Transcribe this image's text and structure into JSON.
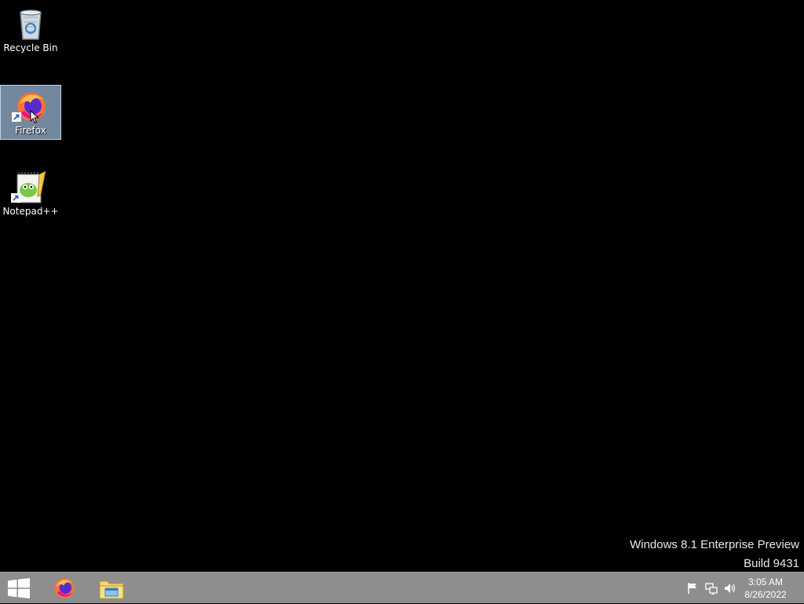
{
  "desktop": {
    "icons": [
      {
        "label": "Recycle Bin",
        "icon": "recycle-bin-icon"
      },
      {
        "label": "Firefox",
        "icon": "firefox-icon",
        "selected": true
      },
      {
        "label": "Notepad++",
        "icon": "notepad-plus-plus-icon"
      }
    ],
    "watermark": {
      "line1": "Windows 8.1 Enterprise Preview",
      "line2": "Build 9431"
    }
  },
  "taskbar": {
    "start_icon": "windows-logo-icon",
    "pinned": [
      {
        "name": "Firefox",
        "icon": "firefox-icon"
      },
      {
        "name": "File Explorer",
        "icon": "file-explorer-icon"
      }
    ],
    "tray": {
      "icons": [
        "flag-icon",
        "network-icon",
        "volume-icon"
      ],
      "time": "3:05 AM",
      "date": "8/26/2022"
    }
  },
  "colors": {
    "desktop_bg": "#000000",
    "taskbar_bg": "#8e8e8e",
    "selection": "#99b4d1"
  }
}
